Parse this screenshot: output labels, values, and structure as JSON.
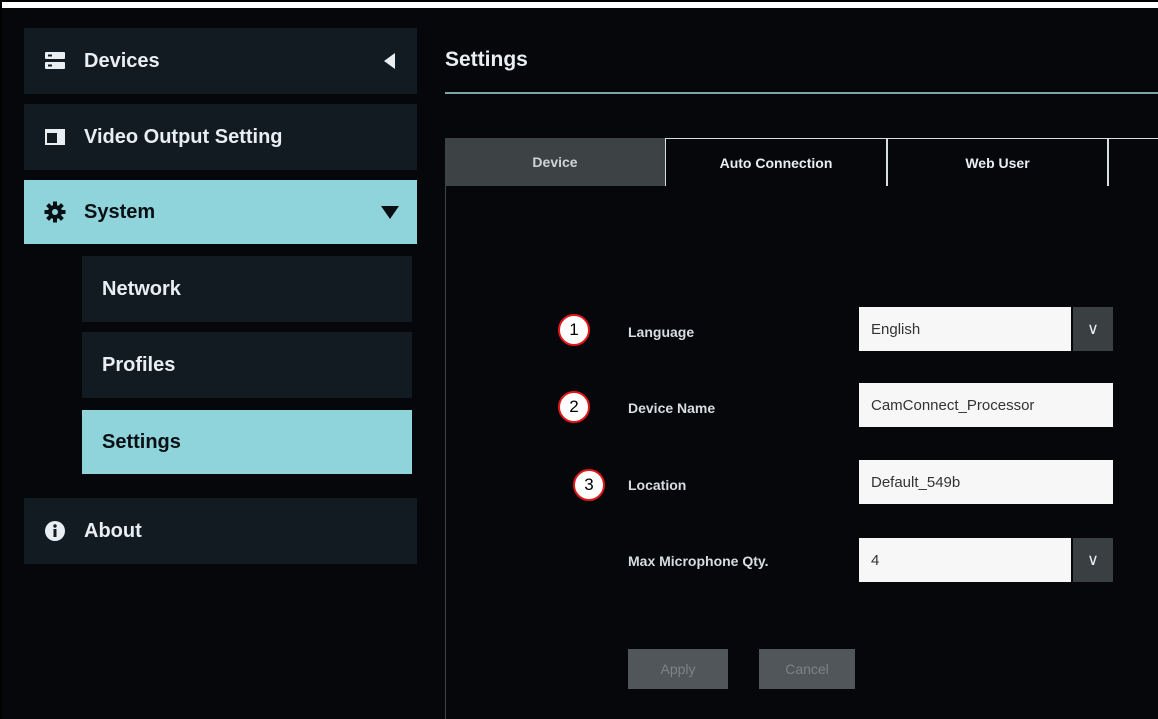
{
  "sidebar": {
    "devices": {
      "label": "Devices",
      "icon": "server-icon"
    },
    "video_output": {
      "label": "Video Output Setting",
      "icon": "monitor-icon"
    },
    "system": {
      "label": "System",
      "icon": "gear-icon"
    },
    "sub_items": [
      "Network",
      "Profiles",
      "Settings"
    ],
    "about": {
      "label": "About",
      "icon": "info-icon"
    }
  },
  "main": {
    "title": "Settings",
    "tabs": [
      "Device",
      "Auto Connection",
      "Web User"
    ],
    "active_tab": "Device",
    "fields": {
      "language": {
        "badge": "1",
        "label": "Language",
        "value": "English"
      },
      "device_name": {
        "badge": "2",
        "label": "Device Name",
        "value": "CamConnect_Processor"
      },
      "location": {
        "badge": "3",
        "label": "Location",
        "value": "Default_549b"
      },
      "max_mic": {
        "label": "Max Microphone Qty.",
        "value": "4"
      }
    },
    "buttons": {
      "apply": "Apply",
      "cancel": "Cancel"
    }
  },
  "colors": {
    "accent": "#8fd4db",
    "background": "#05070b",
    "nav_item": "#131b22",
    "badge_ring": "#e01818"
  }
}
